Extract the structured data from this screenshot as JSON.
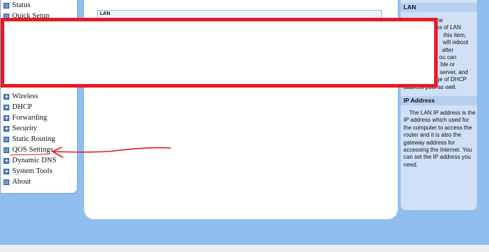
{
  "sidebar": {
    "items": [
      {
        "label": "Status",
        "icon": "page-icon"
      },
      {
        "label": "Quick Setup",
        "icon": "page-icon"
      },
      {
        "label": "Wireless",
        "icon": "plus-icon"
      },
      {
        "label": "DHCP",
        "icon": "plus-icon"
      },
      {
        "label": "Forwarding",
        "icon": "plus-icon"
      },
      {
        "label": "Security",
        "icon": "plus-icon"
      },
      {
        "label": "Static Routing",
        "icon": "page-icon"
      },
      {
        "label": "QOS Settings",
        "icon": "page-icon"
      },
      {
        "label": "Dynamic DNS",
        "icon": "plus-icon"
      },
      {
        "label": "System Tools",
        "icon": "plus-icon"
      },
      {
        "label": "About",
        "icon": "page-icon"
      }
    ]
  },
  "main": {
    "section_title": "LAN"
  },
  "help": {
    "lan": {
      "title": "LAN",
      "fragments": [
        "ge the",
        "ress of LAN",
        "this item,",
        "will reboot",
        "after",
        "ou can",
        "ble or",
        "server, and",
        "ge of DHCP",
        "address pool as well."
      ]
    },
    "ip": {
      "title": "IP Address",
      "text": "The LAN IP address is the IP address which used for the computer to access the router and it is also the gateway address for accessing the Internet. You can set the IP address you need."
    }
  },
  "colors": {
    "background": "#8fbdf0",
    "annotation": "#e51b24",
    "help_panel": "#cfe0f7"
  }
}
